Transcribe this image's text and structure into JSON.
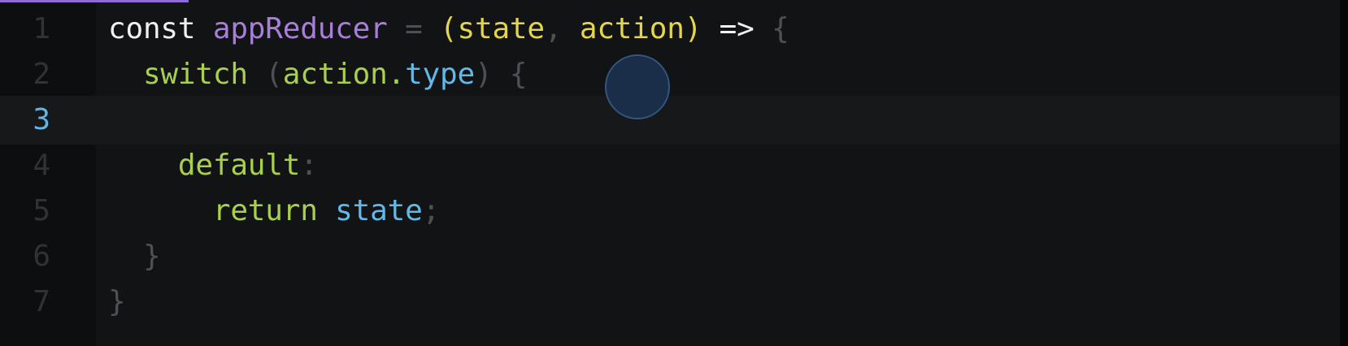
{
  "active_line": 3,
  "colors": {
    "background": "#121314",
    "gutter": "#0d0e0f",
    "active_line_number": "#5fb6e6",
    "line_number": "#2f3336",
    "keyword": "#e6e8ea",
    "function_name": "#a77ed8",
    "parameter": "#e3d64c",
    "switch_keyword": "#a8cf4e",
    "identifier": "#62b8e8",
    "punctuation": "#4b5156"
  },
  "lines": [
    {
      "number": "1",
      "tokens": [
        "const",
        " ",
        "appReducer",
        " = ",
        "(",
        "state",
        ", ",
        "action",
        ")",
        " ",
        "=>",
        " {"
      ]
    },
    {
      "number": "2",
      "tokens": [
        "  ",
        "switch",
        " (",
        "action.",
        "type",
        ") {"
      ]
    },
    {
      "number": "3",
      "tokens": []
    },
    {
      "number": "4",
      "tokens": [
        "    ",
        "default",
        ":"
      ]
    },
    {
      "number": "5",
      "tokens": [
        "      ",
        "return",
        " ",
        "state",
        ";"
      ]
    },
    {
      "number": "6",
      "tokens": [
        "  ",
        "}"
      ]
    },
    {
      "number": "7",
      "tokens": [
        "}"
      ]
    }
  ]
}
